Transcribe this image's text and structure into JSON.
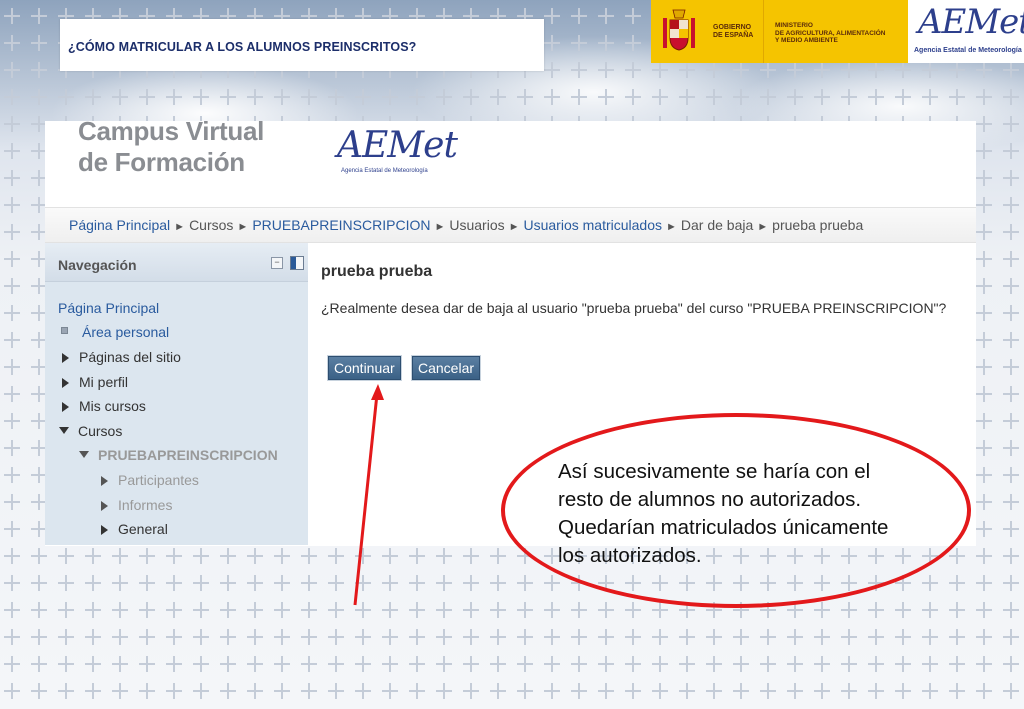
{
  "slide": {
    "title": "¿CÓMO MATRICULAR A LOS ALUMNOS PREINSCRITOS?",
    "note_lines": [
      "Así sucesivamente se haría con el",
      "resto de alumnos no autorizados.",
      "Quedarían matriculados únicamente",
      "los autorizados."
    ]
  },
  "banner": {
    "gov_line1": "GOBIERNO",
    "gov_line2": "DE ESPAÑA",
    "ministry_line1": "MINISTERIO",
    "ministry_line2": "DE AGRICULTURA, ALIMENTACIÓN",
    "ministry_line3": "Y MEDIO AMBIENTE",
    "aemet_logo": "AEMet",
    "aemet_subtitle": "Agencia Estatal de Meteorología"
  },
  "site": {
    "title_line1": "Campus Virtual",
    "title_line2": "de Formación",
    "logo": "AEMet",
    "logo_subtitle": "Agencia Estatal de Meteorología"
  },
  "breadcrumb": {
    "items": [
      {
        "label": "Página Principal",
        "link": true
      },
      {
        "label": "Cursos",
        "link": false
      },
      {
        "label": "PRUEBAPREINSCRIPCION",
        "link": true
      },
      {
        "label": "Usuarios",
        "link": false
      },
      {
        "label": "Usuarios matriculados",
        "link": true
      },
      {
        "label": "Dar de baja",
        "link": false
      },
      {
        "label": "prueba prueba",
        "link": false
      }
    ],
    "separator": "►"
  },
  "navigation": {
    "title": "Navegación",
    "collapse_symbol": "−",
    "items": {
      "home": "Página Principal",
      "personal": "Área personal",
      "site_pages": "Páginas del sitio",
      "profile": "Mi perfil",
      "my_courses": "Mis cursos",
      "courses": "Cursos",
      "course": "PRUEBAPREINSCRIPCION",
      "participants": "Participantes",
      "reports": "Informes",
      "general": "General"
    }
  },
  "main": {
    "user_name": "prueba prueba",
    "confirm_message": "¿Realmente desea dar de baja al usuario \"prueba prueba\" del curso \"PRUEBA PREINSCRIPCION\"?",
    "continue_label": "Continuar",
    "cancel_label": "Cancelar"
  },
  "colors": {
    "annotation": "#e3191b",
    "link": "#2a5b9e",
    "button": "#3b6186",
    "gov_band": "#f5c400"
  }
}
